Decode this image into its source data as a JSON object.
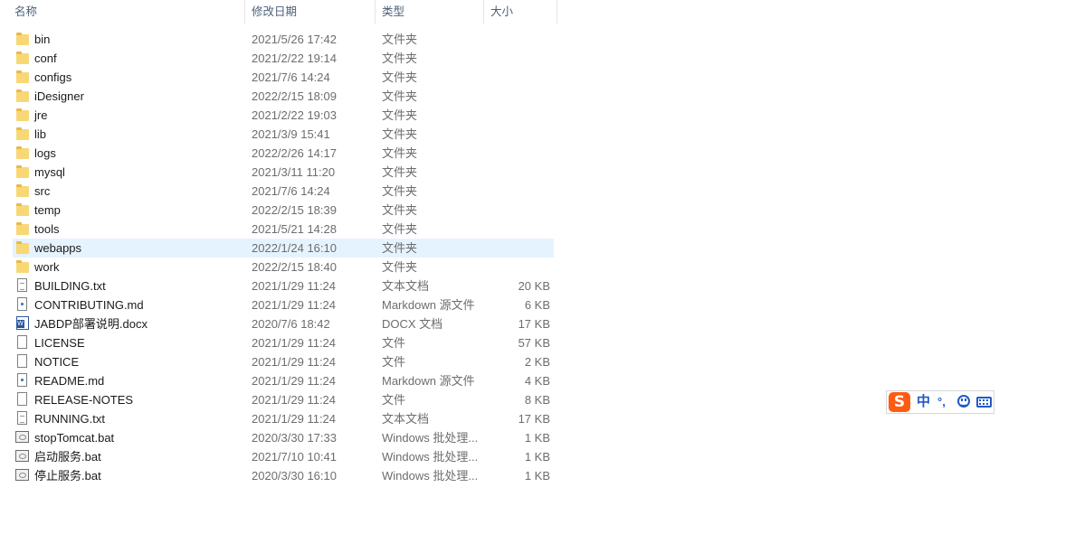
{
  "columns": {
    "name": "名称",
    "date": "修改日期",
    "type": "类型",
    "size": "大小",
    "sort_indicator": "^"
  },
  "files": [
    {
      "name": "bin",
      "date": "2021/5/26 17:42",
      "type": "文件夹",
      "size": "",
      "icon": "folder-icon",
      "selected": false
    },
    {
      "name": "conf",
      "date": "2021/2/22 19:14",
      "type": "文件夹",
      "size": "",
      "icon": "folder-icon",
      "selected": false
    },
    {
      "name": "configs",
      "date": "2021/7/6 14:24",
      "type": "文件夹",
      "size": "",
      "icon": "folder-icon",
      "selected": false
    },
    {
      "name": "iDesigner",
      "date": "2022/2/15 18:09",
      "type": "文件夹",
      "size": "",
      "icon": "folder-icon",
      "selected": false
    },
    {
      "name": "jre",
      "date": "2021/2/22 19:03",
      "type": "文件夹",
      "size": "",
      "icon": "folder-icon",
      "selected": false
    },
    {
      "name": "lib",
      "date": "2021/3/9 15:41",
      "type": "文件夹",
      "size": "",
      "icon": "folder-icon",
      "selected": false
    },
    {
      "name": "logs",
      "date": "2022/2/26 14:17",
      "type": "文件夹",
      "size": "",
      "icon": "folder-icon",
      "selected": false
    },
    {
      "name": "mysql",
      "date": "2021/3/11 11:20",
      "type": "文件夹",
      "size": "",
      "icon": "folder-icon",
      "selected": false
    },
    {
      "name": "src",
      "date": "2021/7/6 14:24",
      "type": "文件夹",
      "size": "",
      "icon": "folder-icon",
      "selected": false
    },
    {
      "name": "temp",
      "date": "2022/2/15 18:39",
      "type": "文件夹",
      "size": "",
      "icon": "folder-icon",
      "selected": false
    },
    {
      "name": "tools",
      "date": "2021/5/21 14:28",
      "type": "文件夹",
      "size": "",
      "icon": "folder-icon",
      "selected": false
    },
    {
      "name": "webapps",
      "date": "2022/1/24 16:10",
      "type": "文件夹",
      "size": "",
      "icon": "folder-icon",
      "selected": true
    },
    {
      "name": "work",
      "date": "2022/2/15 18:40",
      "type": "文件夹",
      "size": "",
      "icon": "folder-icon",
      "selected": false
    },
    {
      "name": "BUILDING.txt",
      "date": "2021/1/29 11:24",
      "type": "文本文档",
      "size": "20 KB",
      "icon": "text-document-icon",
      "selected": false
    },
    {
      "name": "CONTRIBUTING.md",
      "date": "2021/1/29 11:24",
      "type": "Markdown 源文件",
      "size": "6 KB",
      "icon": "markdown-file-icon",
      "selected": false
    },
    {
      "name": "JABDP部署说明.docx",
      "date": "2020/7/6 18:42",
      "type": "DOCX 文档",
      "size": "17 KB",
      "icon": "word-document-icon",
      "selected": false
    },
    {
      "name": "LICENSE",
      "date": "2021/1/29 11:24",
      "type": "文件",
      "size": "57 KB",
      "icon": "file-icon",
      "selected": false
    },
    {
      "name": "NOTICE",
      "date": "2021/1/29 11:24",
      "type": "文件",
      "size": "2 KB",
      "icon": "file-icon",
      "selected": false
    },
    {
      "name": "README.md",
      "date": "2021/1/29 11:24",
      "type": "Markdown 源文件",
      "size": "4 KB",
      "icon": "markdown-file-icon",
      "selected": false
    },
    {
      "name": "RELEASE-NOTES",
      "date": "2021/1/29 11:24",
      "type": "文件",
      "size": "8 KB",
      "icon": "file-icon",
      "selected": false
    },
    {
      "name": "RUNNING.txt",
      "date": "2021/1/29 11:24",
      "type": "文本文档",
      "size": "17 KB",
      "icon": "text-document-icon",
      "selected": false
    },
    {
      "name": "stopTomcat.bat",
      "date": "2020/3/30 17:33",
      "type": "Windows 批处理...",
      "size": "1 KB",
      "icon": "batch-file-icon",
      "selected": false
    },
    {
      "name": "启动服务.bat",
      "date": "2021/7/10 10:41",
      "type": "Windows 批处理...",
      "size": "1 KB",
      "icon": "batch-file-icon",
      "selected": false
    },
    {
      "name": "停止服务.bat",
      "date": "2020/3/30 16:10",
      "type": "Windows 批处理...",
      "size": "1 KB",
      "icon": "batch-file-icon",
      "selected": false
    }
  ],
  "ime_toolbar": {
    "logo_text": "S",
    "mode_label": "中",
    "punct_label": "°,",
    "emoji_icon": "smiley-icon",
    "keyboard_icon": "keyboard-icon"
  },
  "colors": {
    "selection": "#e5f3ff",
    "folder": "#f8d775",
    "ime_accent": "#1e5ac8",
    "ime_logo": "#ff5b13"
  }
}
